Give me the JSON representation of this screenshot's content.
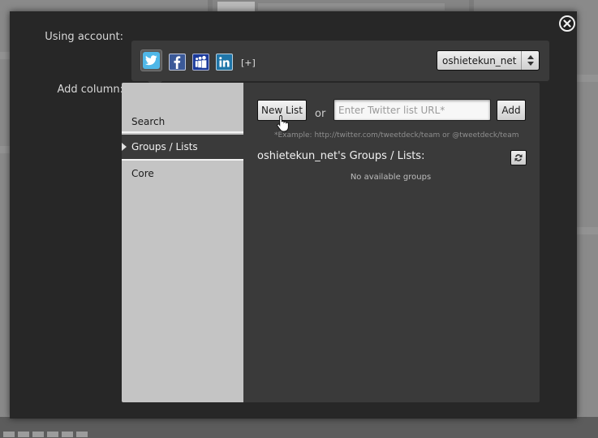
{
  "dialog": {
    "using_account_label": "Using account:",
    "add_column_label": "Add column:",
    "more_services": "[+]",
    "selected_account": "oshietekun_net"
  },
  "services": [
    "twitter-icon",
    "facebook-icon",
    "myspace-icon",
    "linkedin-icon"
  ],
  "categories": [
    {
      "label": "Search"
    },
    {
      "label": "Groups / Lists",
      "selected": true
    },
    {
      "label": "Core"
    }
  ],
  "lists": {
    "new_list_label": "New List",
    "or_text": "or",
    "url_placeholder": "Enter Twitter list URL*",
    "add_label": "Add",
    "example_text": "*Example: http://twitter.com/tweetdeck/team or @tweetdeck/team",
    "groups_title": "oshietekun_net's Groups / Lists:",
    "empty_text": "No available groups"
  },
  "colors": {
    "twitter": "#4fb7e8",
    "facebook": "#3b5998",
    "myspace": "#1b3a9b",
    "linkedin": "#1f76a9"
  }
}
